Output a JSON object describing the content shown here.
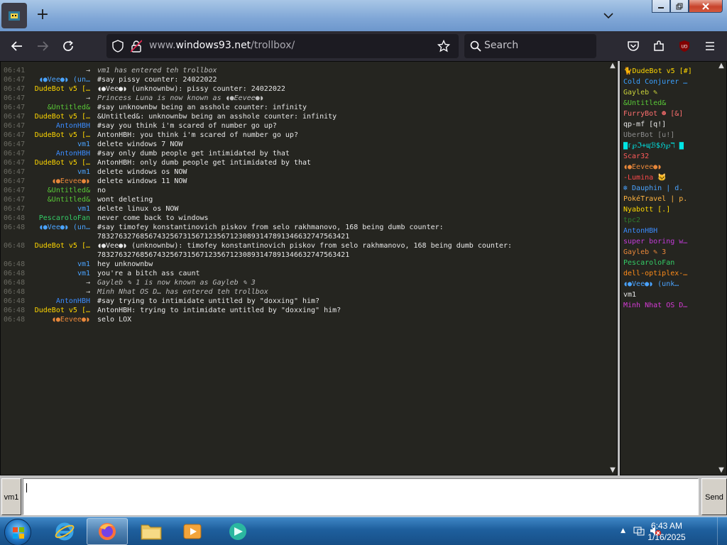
{
  "browser": {
    "new_tab": "+",
    "url_prefix": "www.",
    "url_host": "windows93.net",
    "url_path": "/trollbox/",
    "search_placeholder": "Search"
  },
  "chat": {
    "messages": [
      {
        "time": "06:41",
        "nick": "→",
        "nick_color": "#c9c9c9",
        "text": "vm1 has entered teh trollbox",
        "system": true
      },
      {
        "time": "06:47",
        "nick": "◖●Vee●◗ (un…",
        "nick_color": "#4aa3ff",
        "text": "#say pissy counter: 24022022"
      },
      {
        "time": "06:47",
        "nick": "DudeBot v5 […",
        "nick_color": "#ffd700",
        "text": "◖●Vee●◗ (unknownbw): pissy counter: 24022022"
      },
      {
        "time": "06:47",
        "nick": "→",
        "nick_color": "#c9c9c9",
        "text": "Princess Luna is now known as ◖●Eevee●◗",
        "system": true
      },
      {
        "time": "06:47",
        "nick": "&Untitled&",
        "nick_color": "#59c837",
        "text": "#say unknownbw being an asshole counter: infinity"
      },
      {
        "time": "06:47",
        "nick": "DudeBot v5 […",
        "nick_color": "#ffd700",
        "text": "&Untitled&: unknownbw being an asshole counter: infinity"
      },
      {
        "time": "06:47",
        "nick": "AntonHBH",
        "nick_color": "#3b8cff",
        "text": "#say you think i'm scared of number go up?"
      },
      {
        "time": "06:47",
        "nick": "DudeBot v5 […",
        "nick_color": "#ffd700",
        "text": "AntonHBH: you think i'm scared of number go up?"
      },
      {
        "time": "06:47",
        "nick": "vm1",
        "nick_color": "#4aa3ff",
        "text": "delete windows 7 NOW"
      },
      {
        "time": "06:47",
        "nick": "AntonHBH",
        "nick_color": "#3b8cff",
        "text": "#say only dumb people get intimidated by that"
      },
      {
        "time": "06:47",
        "nick": "DudeBot v5 […",
        "nick_color": "#ffd700",
        "text": "AntonHBH: only dumb people get intimidated by that"
      },
      {
        "time": "06:47",
        "nick": "vm1",
        "nick_color": "#4aa3ff",
        "text": "delete windows os NOW"
      },
      {
        "time": "06:47",
        "nick": "◖●Eevee●◗",
        "nick_color": "#e8873a",
        "text": "delete windows 11 NOW"
      },
      {
        "time": "06:47",
        "nick": "&Untitled&",
        "nick_color": "#59c837",
        "text": "no"
      },
      {
        "time": "06:47",
        "nick": "&Untitled&",
        "nick_color": "#59c837",
        "text": "wont deleting"
      },
      {
        "time": "06:47",
        "nick": "vm1",
        "nick_color": "#4aa3ff",
        "text": "delete linux os NOW"
      },
      {
        "time": "06:48",
        "nick": "PescaroloFan",
        "nick_color": "#33cc66",
        "text": "never come back to windows"
      },
      {
        "time": "06:48",
        "nick": "◖●Vee●◗ (un…",
        "nick_color": "#4aa3ff",
        "text": "#say timofey konstantinovich piskov from selo rakhmanovo, 168 being dumb counter:",
        "cont": "78327632768567432567315671235671230893147891346632747563421"
      },
      {
        "time": "06:48",
        "nick": "DudeBot v5 […",
        "nick_color": "#ffd700",
        "text": "◖●Vee●◗ (unknownbw): timofey konstantinovich piskov from selo rakhmanovo, 168 being dumb counter:",
        "cont": "78327632768567432567315671235671230893147891346632747563421"
      },
      {
        "time": "06:48",
        "nick": "vm1",
        "nick_color": "#4aa3ff",
        "text": "hey unknownbw"
      },
      {
        "time": "06:48",
        "nick": "vm1",
        "nick_color": "#4aa3ff",
        "text": "you're a bitch ass caunt"
      },
      {
        "time": "06:48",
        "nick": "→",
        "nick_color": "#c9c9c9",
        "text": "Gayleb ✎ 1 is now known as Gayleb ✎ 3",
        "system": true
      },
      {
        "time": "06:48",
        "nick": "→",
        "nick_color": "#c9c9c9",
        "text": "Minh Nhat OS D… has entered teh trollbox",
        "system": true
      },
      {
        "time": "06:48",
        "nick": "AntonHBH",
        "nick_color": "#3b8cff",
        "text": "#say trying to intimidate untitled by \"doxxing\" him?"
      },
      {
        "time": "06:48",
        "nick": "DudeBot v5 […",
        "nick_color": "#ffd700",
        "text": "AntonHBH: trying to intimidate untitled by \"doxxing\" him?"
      },
      {
        "time": "06:48",
        "nick": "◖●Eevee●◗",
        "nick_color": "#e8873a",
        "text": "selo LOX"
      }
    ]
  },
  "users": [
    {
      "name": "🐈DudeBot v5 [#]",
      "color": "#ffd700"
    },
    {
      "name": "Cold Conjurer …",
      "color": "#3aa0ff"
    },
    {
      "name": "Gayleb ✎",
      "color": "#c9d23a"
    },
    {
      "name": "&Untitled&",
      "color": "#59c837"
    },
    {
      "name": "FurryBot ☻ [&]",
      "color": "#ff6f6f"
    },
    {
      "name": "qp-mf [q!]",
      "color": "#e8e8e8"
    },
    {
      "name": "UberBot [u!]",
      "color": "#8e8e8e"
    },
    {
      "name": "▇ᴦ℘ℑ+ɰℬ$ℌ℘ℸ ▇",
      "color": "#00e5e5"
    },
    {
      "name": "Scar32",
      "color": "#ff5a5a"
    },
    {
      "name": "◖●Eevee●◗",
      "color": "#e8873a"
    },
    {
      "name": "-Lumina 🐱",
      "color": "#ff4a4a"
    },
    {
      "name": "❄ Dauphin | d.",
      "color": "#4aa3ff"
    },
    {
      "name": "PokéTravel | p.",
      "color": "#ffb340"
    },
    {
      "name": "Nyabott [.]",
      "color": "#ffd700"
    },
    {
      "name": "tpc2",
      "color": "#2d7a2d"
    },
    {
      "name": "AntonHBH",
      "color": "#3b8cff"
    },
    {
      "name": "super boring w…",
      "color": "#c23bd8"
    },
    {
      "name": "Gayleb ✎ 3",
      "color": "#e8873a"
    },
    {
      "name": "PescaroloFan",
      "color": "#33cc66"
    },
    {
      "name": "dell-optiplex-…",
      "color": "#ff8c1a"
    },
    {
      "name": "◖●Vee●◗ (unk…",
      "color": "#4aa3ff"
    },
    {
      "name": "vm1",
      "color": "#e8e8e8"
    },
    {
      "name": "Minh Nhat OS D…",
      "color": "#d63bd6"
    }
  ],
  "input": {
    "nick_button": "vm1",
    "message_value": "",
    "send_button": "Send"
  },
  "taskbar": {
    "time": "6:43 AM",
    "date": "1/16/2025"
  }
}
